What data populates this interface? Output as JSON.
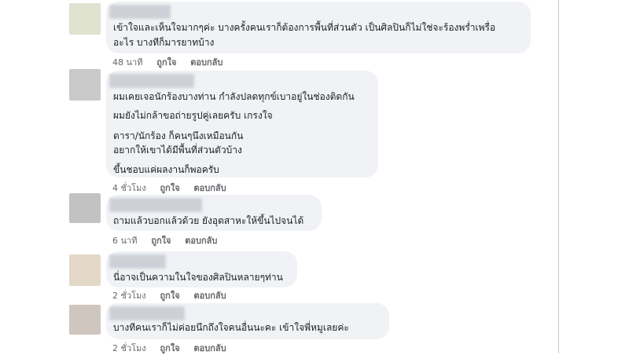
{
  "comments": [
    {
      "lines": [
        "เข้าใจและเห็นใจมากๆค่ะ บางครั้งคนเราก็ต้องการพื้นที่ส่วนตัว เป็นศิลปินก็ไม่ใช่จะร้องพร่ำเพรื่อ",
        "อะไร บางทีก็มารยาทบ้าง"
      ],
      "time": "48 นาที",
      "like_label": "ถูกใจ",
      "reply_label": "ตอบกลับ",
      "avatar_color": "#dfe3cf"
    },
    {
      "lines": [
        "ผมเคยเจอนักร้องบางท่าน กำลังปลดทุกข์เบาอยู่ในช่องติดกัน",
        "ผมยังไม่กล้าขอถ่ายรูปคู่เลยครับ เกรงใจ",
        "ดารา/นักร้อง ก็คนๆนึงเหมือนกัน",
        "อยากให้เขาได้มีพื้นที่ส่วนตัวบ้าง",
        "ขึ้นชอบแค่ผลงานก็พอครับ"
      ],
      "time": "4 ชั่วโมง",
      "like_label": "ถูกใจ",
      "reply_label": "ตอบกลับ",
      "avatar_color": "#c9c9c9"
    },
    {
      "lines": [
        "ถามแล้วบอกแล้วด้วย ยังอุตสาหะให้ขึ้นไปจนได้"
      ],
      "time": "6 นาที",
      "like_label": "ถูกใจ",
      "reply_label": "ตอบกลับ",
      "avatar_color": "#c2c2c2"
    },
    {
      "lines": [
        "นี่อาจเป็นความในใจของศิลปินหลายๆท่าน"
      ],
      "time": "2 ชั่วโมง",
      "like_label": "ถูกใจ",
      "reply_label": "ตอบกลับ",
      "avatar_color": "#e4d9c8"
    },
    {
      "lines": [
        "บางทีคนเราก็ไม่ค่อยนึกถึงใจคนอื่นนะคะ เข้าใจพี่หมูเลยค่ะ"
      ],
      "time": "2 ชั่วโมง",
      "like_label": "ถูกใจ",
      "reply_label": "ตอบกลับ",
      "avatar_color": "#cfc6c0"
    }
  ]
}
